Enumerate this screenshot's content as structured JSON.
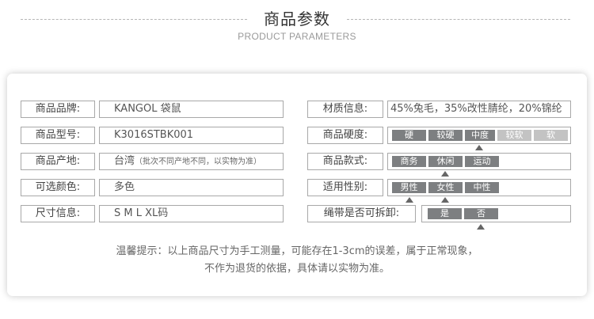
{
  "header": {
    "title": "商品参数",
    "subtitle": "PRODUCT PARAMETERS"
  },
  "left_rows": [
    {
      "label": "商品品牌:",
      "value": "KANGOL 袋鼠"
    },
    {
      "label": "商品型号:",
      "value": "K3016STBK001"
    },
    {
      "label": "商品产地:",
      "value": "台湾",
      "value_note": "（批次不同产地不同，以实物为准）"
    },
    {
      "label": "可选颜色:",
      "value": "多色"
    },
    {
      "label": "尺寸信息:",
      "value": "S M L XL码"
    }
  ],
  "right_rows": [
    {
      "label": "材质信息:",
      "value": "45%兔毛，35%改性腈纶，20%锦纶"
    },
    {
      "label": "商品硬度:",
      "options": [
        "硬",
        "较硬",
        "中度",
        "较软",
        "软"
      ],
      "selected_index": 2
    },
    {
      "label": "商品款式:",
      "options": [
        "商务",
        "休闲",
        "运动"
      ],
      "selected_index": 1
    },
    {
      "label": "适用性别:",
      "options": [
        "男性",
        "女性",
        "中性"
      ],
      "selected_index": 1
    },
    {
      "label": "绳带是否可拆卸:",
      "options": [
        "是",
        "否"
      ],
      "selected_index": 1
    }
  ],
  "note": {
    "line1": "温馨提示：以上商品尺寸为手工测量，可能存在1-3cm的误差，属于正常现象，",
    "line2": "不作为退货的依据，具体请以实物为准。"
  },
  "colors": {
    "segment_dark": "#7d7f81",
    "segment_light": "#c3c3c3",
    "border": "#a8a8a8"
  }
}
